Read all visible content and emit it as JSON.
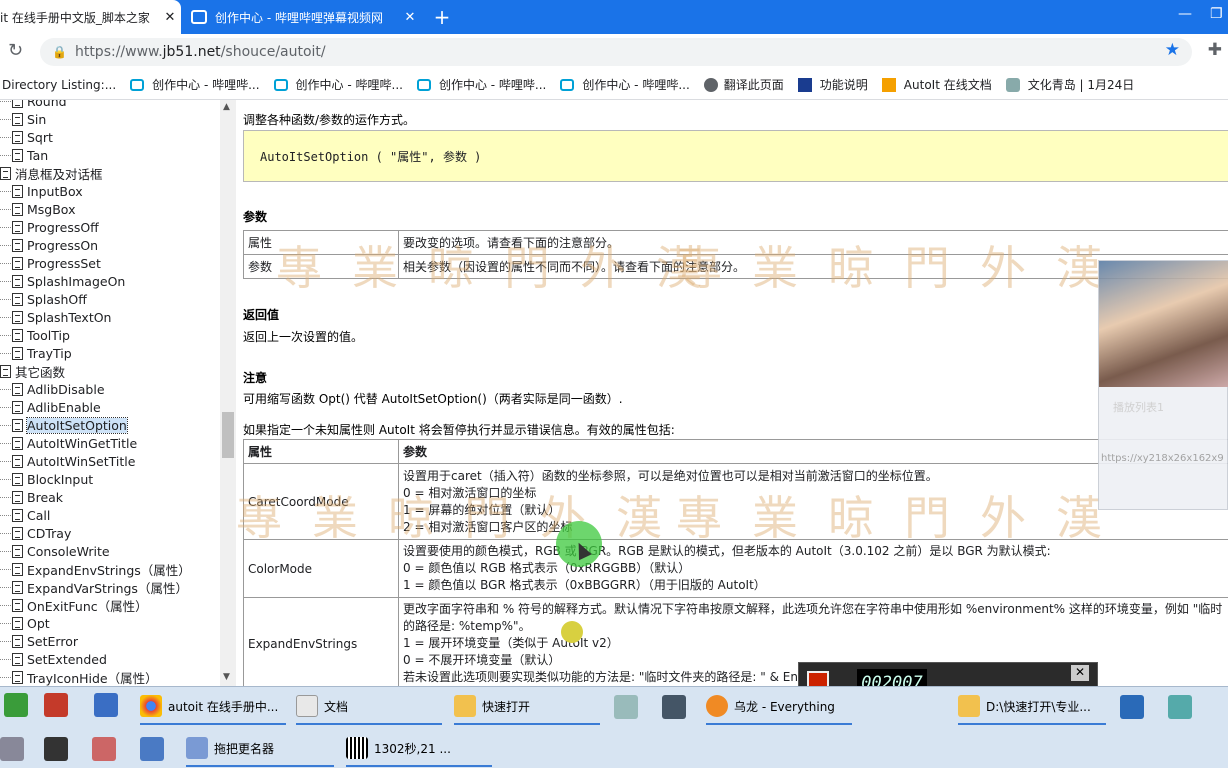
{
  "browser": {
    "tabs": [
      {
        "label": "it 在线手册中文版_脚本之家",
        "active": true
      },
      {
        "label": "创作中心 - 哔哩哔哩弹幕视频网",
        "active": false
      }
    ],
    "url_prefix": "https://www.",
    "url_host": "jb51.net",
    "url_path": "/shouce/autoit/",
    "bookmarks": [
      {
        "label": "Directory Listing:...",
        "icon": "none"
      },
      {
        "label": "创作中心 - 哔哩哔...",
        "icon": "bilibili-icon"
      },
      {
        "label": "创作中心 - 哔哩哔...",
        "icon": "bilibili-icon"
      },
      {
        "label": "创作中心 - 哔哩哔...",
        "icon": "bilibili-icon"
      },
      {
        "label": "创作中心 - 哔哩哔...",
        "icon": "bilibili-icon"
      },
      {
        "label": "翻译此页面",
        "icon": "globe-icon"
      },
      {
        "label": "功能说明",
        "icon": "au-icon"
      },
      {
        "label": "AutoIt 在线文档",
        "icon": "autoit-icon"
      },
      {
        "label": "文化青岛 | 1月24日",
        "icon": "qingdao-icon"
      }
    ]
  },
  "sidebar": {
    "items": [
      {
        "label": "Round",
        "type": "leaf"
      },
      {
        "label": "Sin",
        "type": "leaf"
      },
      {
        "label": "Sqrt",
        "type": "leaf"
      },
      {
        "label": "Tan",
        "type": "leaf"
      },
      {
        "label": "消息框及对话框",
        "type": "folder"
      },
      {
        "label": "InputBox",
        "type": "leaf"
      },
      {
        "label": "MsgBox",
        "type": "leaf"
      },
      {
        "label": "ProgressOff",
        "type": "leaf"
      },
      {
        "label": "ProgressOn",
        "type": "leaf"
      },
      {
        "label": "ProgressSet",
        "type": "leaf"
      },
      {
        "label": "SplashImageOn",
        "type": "leaf"
      },
      {
        "label": "SplashOff",
        "type": "leaf"
      },
      {
        "label": "SplashTextOn",
        "type": "leaf"
      },
      {
        "label": "ToolTip",
        "type": "leaf"
      },
      {
        "label": "TrayTip",
        "type": "leaf"
      },
      {
        "label": "其它函数",
        "type": "folder"
      },
      {
        "label": "AdlibDisable",
        "type": "leaf"
      },
      {
        "label": "AdlibEnable",
        "type": "leaf"
      },
      {
        "label": "AutoItSetOption",
        "type": "leaf",
        "selected": true
      },
      {
        "label": "AutoItWinGetTitle",
        "type": "leaf"
      },
      {
        "label": "AutoItWinSetTitle",
        "type": "leaf"
      },
      {
        "label": "BlockInput",
        "type": "leaf"
      },
      {
        "label": "Break",
        "type": "leaf"
      },
      {
        "label": "Call",
        "type": "leaf"
      },
      {
        "label": "CDTray",
        "type": "leaf"
      },
      {
        "label": "ConsoleWrite",
        "type": "leaf"
      },
      {
        "label": "ExpandEnvStrings（属性）",
        "type": "leaf"
      },
      {
        "label": "ExpandVarStrings（属性）",
        "type": "leaf"
      },
      {
        "label": "OnExitFunc（属性）",
        "type": "leaf"
      },
      {
        "label": "Opt",
        "type": "leaf"
      },
      {
        "label": "SetError",
        "type": "leaf"
      },
      {
        "label": "SetExtended",
        "type": "leaf"
      },
      {
        "label": "TrayIconHide（属性）",
        "type": "leaf"
      }
    ]
  },
  "doc": {
    "intro": "调整各种函数/参数的运作方式。",
    "syntax": "AutoItSetOption ( \"属性\", 参数 )",
    "params_heading": "参数",
    "params": [
      {
        "name": "属性",
        "desc": "要改变的选项。请查看下面的注意部分。"
      },
      {
        "name": "参数",
        "desc": "相关参数（因设置的属性不同而不同）。请查看下面的注意部分。"
      }
    ],
    "return_heading": "返回值",
    "return_text": "返回上一次设置的值。",
    "remarks_heading": "注意",
    "remarks_text": "可用缩写函数 Opt() 代替 AutoItSetOption()（两者实际是同一函数）.",
    "options_intro": "如果指定一个未知属性则 AutoIt 将会暂停执行并显示错误信息。有效的属性包括:",
    "options_header": {
      "col1": "属性",
      "col2": "参数"
    },
    "options": [
      {
        "name": "CaretCoordMode",
        "lines": [
          "设置用于caret（插入符）函数的坐标参照，可以是绝对位置也可以是相对当前激活窗口的坐标位置。",
          "0 = 相对激活窗口的坐标",
          "1 = 屏幕的绝对位置（默认）",
          "2 = 相对激活窗口客户区的坐标"
        ]
      },
      {
        "name": "ColorMode",
        "lines": [
          "设置要使用的颜色模式，RGB 或 BGR。RGB 是默认的模式，但老版本的 AutoIt（3.0.102 之前）是以 BGR 为默认模式:",
          "0 = 颜色值以 RGB 格式表示（0xRRGGBB）（默认）",
          "1 = 颜色值以 BGR 格式表示（0xBBGGRR）（用于旧版的 AutoIt）"
        ]
      },
      {
        "name": "ExpandEnvStrings",
        "lines": [
          "更改字面字符串和 % 符号的解释方式。默认情况下字符串按原文解释，此选项允许您在字符串中使用形如 %environment% 这样的环境变量，例如 \"临时",
          "的路径是: %temp%\"。",
          "1 = 展开环境变量（类似于 AutoIt v2）",
          "0 = 不展开环境变量（默认）",
          "若未设置此选项则要实现类似功能的方法是: \"临时文件夹的路径是: \" & EnvGet(\"temp\")"
        ]
      }
    ]
  },
  "watermark": "專業晾門外漢",
  "float_panel": {
    "label": "播放列表1",
    "url": "https://xy218x26x162x9"
  },
  "recorder": {
    "counter": "002007",
    "close": "✕"
  },
  "taskbar": {
    "row1": [
      {
        "label": "autoit 在线手册中...",
        "active": true
      },
      {
        "label": "文档",
        "active": false
      },
      {
        "label": "快速打开",
        "active": false
      },
      {
        "label": "乌龙 - Everything",
        "active": false
      },
      {
        "label": "D:\\快速打开\\专业...",
        "active": false
      }
    ],
    "row2": [
      {
        "label": "拖把更名器"
      },
      {
        "label": "1302秒,21 ..."
      }
    ]
  },
  "colors": {
    "chrome_blue": "#1a73e8",
    "syntax_bg": "#ffffc0",
    "taskbar": "#d7e4f2"
  }
}
